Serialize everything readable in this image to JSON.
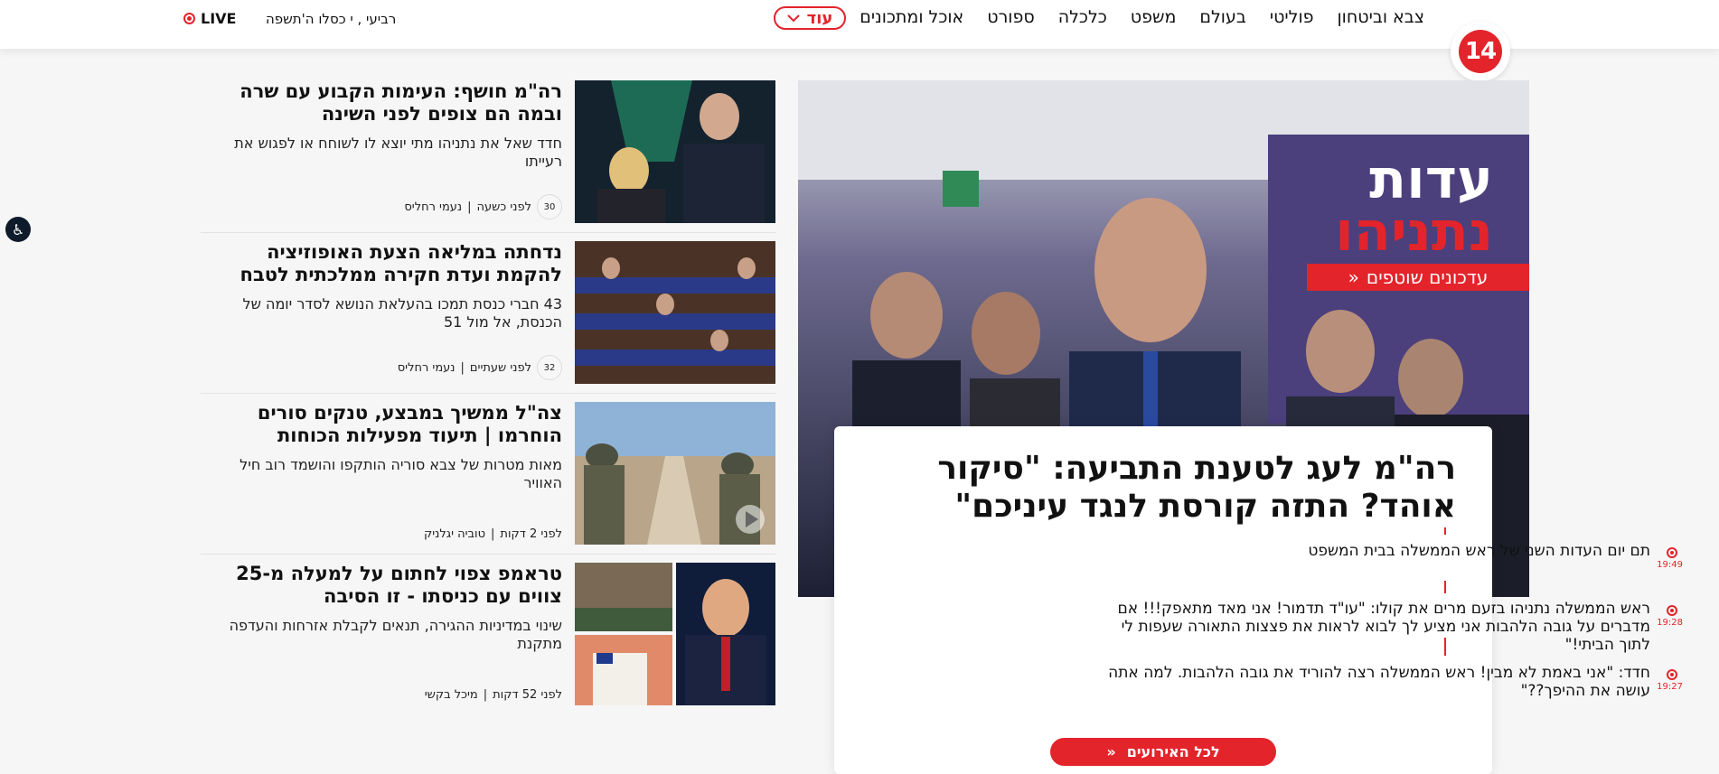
{
  "brand": {
    "logo_text": "14"
  },
  "nav": {
    "items": [
      "צבא וביטחון",
      "פוליטי",
      "בעולם",
      "משפט",
      "כלכלה",
      "ספורט",
      "אוכל ומתכונים"
    ],
    "more_label": "עוד",
    "date": "רביעי , י כסלו ה'תשפה",
    "live_label": "LIVE"
  },
  "hero": {
    "overlay_line1": "עדות",
    "overlay_line2": "נתניהו",
    "banner": "עדכונים שוטפים",
    "headline": "רה\"מ לעג לטענת התביעה: \"סיקור אוהד? התזה קורסת לנגד עיניכם\"",
    "timeline": [
      {
        "time": "19:49",
        "text": "תם יום העדות השני של ראש הממשלה בבית המשפט"
      },
      {
        "time": "19:28",
        "text": "ראש הממשלה נתניהו בזעם מרים את קולו: \"עו\"ד תדמור! אני מאד מתאפק!!! אם מדברים על גובה הלהבות אני מציע לך לבוא לראות את פצצות התאורה שעפות לי לתוך הביתי!\""
      },
      {
        "time": "19:27",
        "text": "חדד: \"אני באמת לא מבין! ראש הממשלה רצה להוריד את גובה הלהבות. למה אתה עושה את ההיפך??\""
      }
    ],
    "cta": "לכל האירועים"
  },
  "articles": [
    {
      "title": "רה\"מ חושף: העימות הקבוע עם שרה ובמה הם צופים לפני השינה",
      "subtitle": "חדד שאל את נתניהו מתי יוצא לו לשוחח או לפגוש את רעייתו",
      "time": "לפני כשעה",
      "author": "נעמי רחליס",
      "comments": "30"
    },
    {
      "title": "נדחתה במליאה הצעת האופוזיציה להקמת ועדת חקירה ממלכתית לטבח",
      "subtitle": "43 חברי כנסת תמכו בהעלאת הנושא לסדר יומה של הכנסת, אל מול 51",
      "time": "לפני שעתיים",
      "author": "נעמי רחליס",
      "comments": "32"
    },
    {
      "title": "צה\"ל ממשיך במבצע, טנקים סורים הוחרמו | תיעוד מפעילות הכוחות",
      "subtitle": "מאות מטרות של צבא סוריה הותקפו והושמד רוב חיל האוויר",
      "time": "לפני 2 דקות",
      "author": "טוביה יגלניק",
      "comments": ""
    },
    {
      "title": "טראמפ צפוי לחתום על למעלה מ-25 צווים עם כניסתו - זו הסיבה",
      "subtitle": "שינוי במדיניות ההגירה, תנאים לקבלת אזרחות והעדפה מתקנת",
      "time": "לפני 52 דקות",
      "author": "מיכל בקשי",
      "comments": ""
    }
  ]
}
